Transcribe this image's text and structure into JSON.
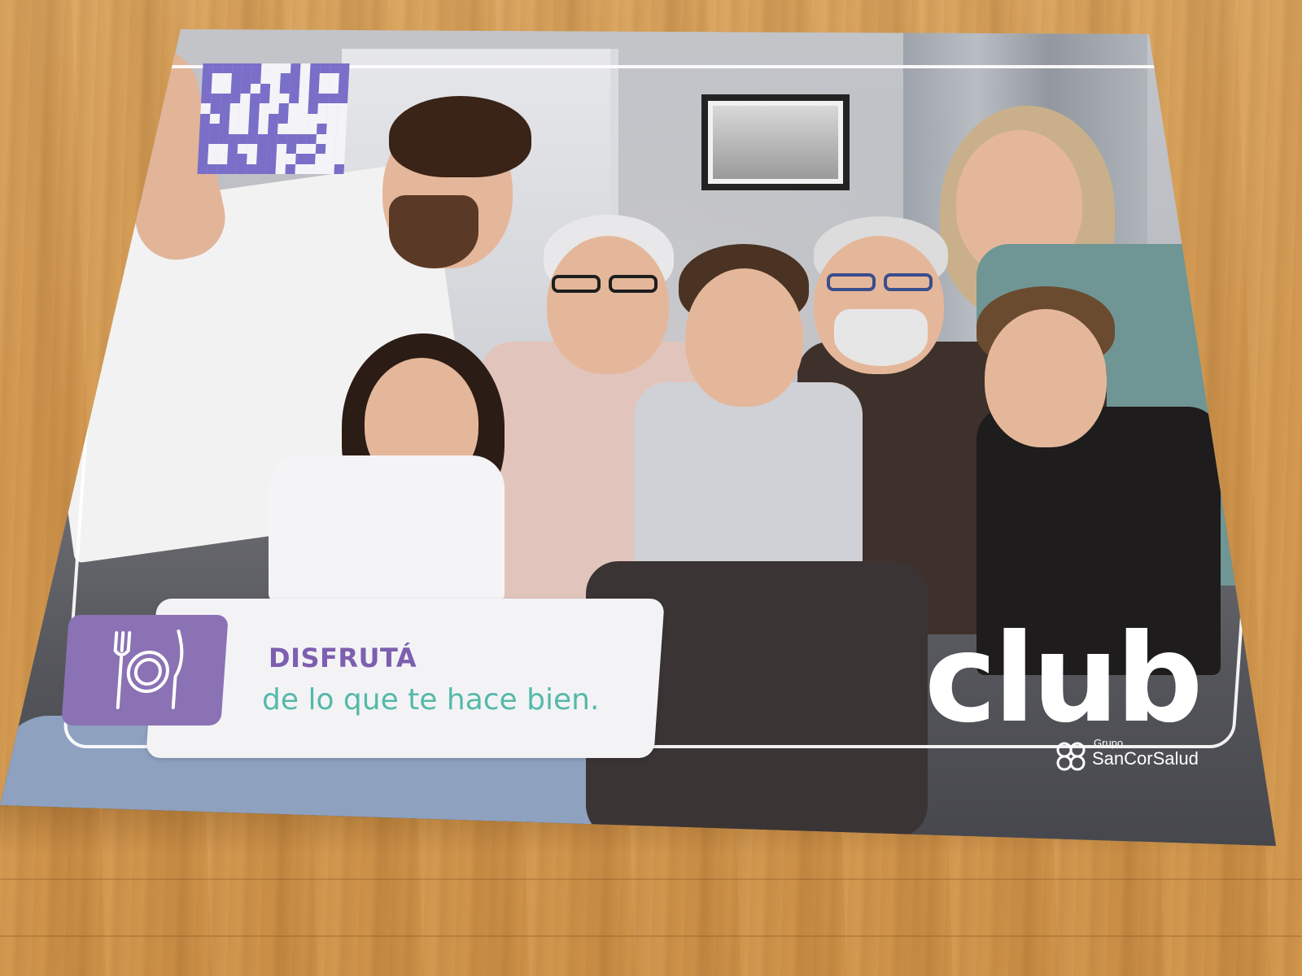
{
  "poster": {
    "message": {
      "title": "DISFRUTÁ",
      "subtitle": "de lo que te hace bien.",
      "icon": "plate-fork-knife-icon"
    },
    "logo_word": "club",
    "brand": {
      "prefix": "Grupo",
      "name": "SanCorSalud"
    },
    "qr_code": "qr-code-icon",
    "colors": {
      "accent_purple": "#8a72b4",
      "title_purple": "#7d5fb0",
      "subtitle_teal": "#55b9a8",
      "qr_color": "#7a6fc8"
    }
  }
}
